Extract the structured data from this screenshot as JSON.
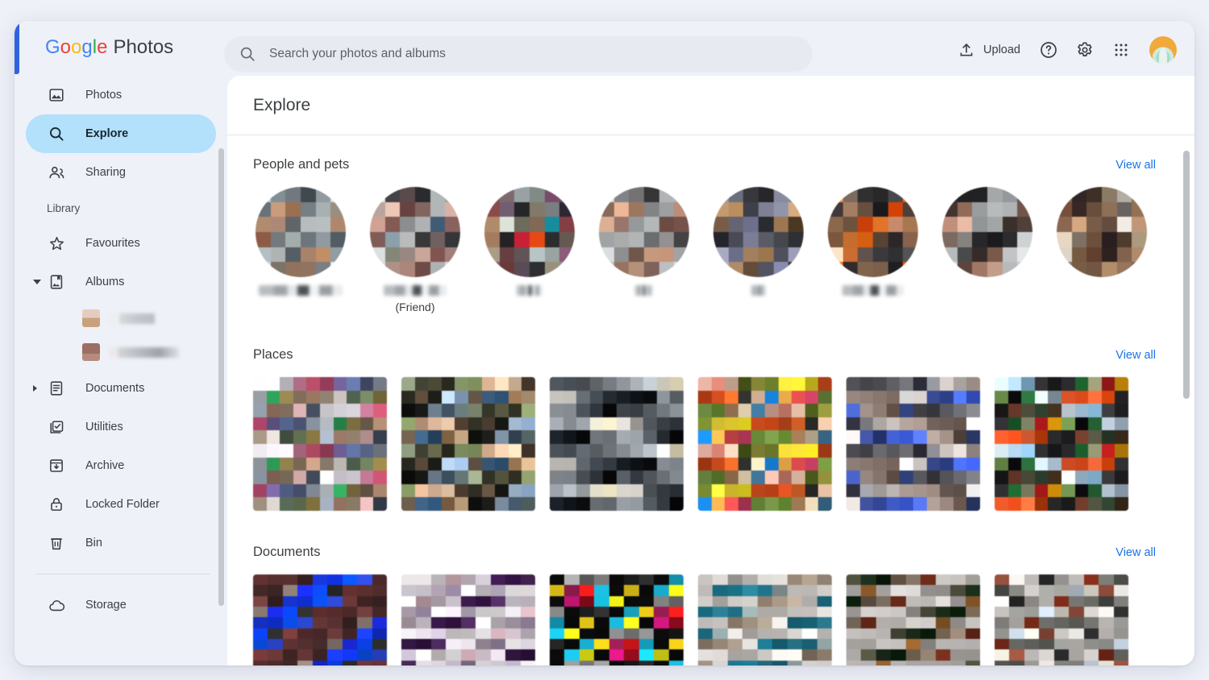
{
  "app": {
    "brand_google": [
      "G",
      "o",
      "o",
      "g",
      "l",
      "e"
    ],
    "brand_word": "Photos",
    "accent_blue": "#2f63e0"
  },
  "search": {
    "placeholder": "Search your photos and albums",
    "value": "",
    "icon": "search-icon"
  },
  "toolbar": {
    "upload_label": "Upload",
    "upload_icon": "upload-icon",
    "help_icon": "help-circle-icon",
    "settings_icon": "gear-icon",
    "apps_icon": "apps-grid-icon",
    "avatar_icon": "account-avatar"
  },
  "sidebar": {
    "items": [
      {
        "label": "Photos",
        "icon": "photo-icon",
        "active": false
      },
      {
        "label": "Explore",
        "icon": "search-icon",
        "active": true
      },
      {
        "label": "Sharing",
        "icon": "people-share-icon",
        "active": false
      }
    ],
    "library_label": "Library",
    "library_items": [
      {
        "label": "Favourites",
        "icon": "star-icon",
        "active": false,
        "caret": null
      },
      {
        "label": "Albums",
        "icon": "album-icon",
        "active": false,
        "caret": "open"
      },
      {
        "label": "Documents",
        "icon": "document-icon",
        "active": false,
        "caret": "closed"
      },
      {
        "label": "Utilities",
        "icon": "utilities-icon",
        "active": false,
        "caret": null
      },
      {
        "label": "Archive",
        "icon": "archive-icon",
        "active": false,
        "caret": null
      },
      {
        "label": "Locked Folder",
        "icon": "lock-icon",
        "active": false,
        "caret": null
      },
      {
        "label": "Bin",
        "icon": "trash-icon",
        "active": false,
        "caret": null
      }
    ],
    "album_children": [
      {
        "label_redacted": true,
        "label_width": 56,
        "thumb_color": "#c9a27b"
      },
      {
        "label_redacted": true,
        "label_width": 86,
        "thumb_color": "#9b6f62"
      }
    ],
    "footer_items": [
      {
        "label": "Storage",
        "icon": "cloud-icon",
        "active": false
      }
    ],
    "highlight_color": "#b3e0fb"
  },
  "main": {
    "page_title": "Explore",
    "view_all_label": "View all",
    "link_color": "#1a73e8",
    "sections": [
      {
        "title": "People and pets",
        "type": "people",
        "people": [
          {
            "name_redacted": true,
            "name_width": 104,
            "caption": "",
            "palette": [
              "#b9c0c0",
              "#6f7b80",
              "#8b949a",
              "#49525a",
              "#97a0a4",
              "#cfd5d4",
              "#5c666e",
              "#a9836a",
              "#b6855f",
              "#7f8a90",
              "#a9b1b2",
              "#8f8578",
              "#9a7a62",
              "#8e7160",
              "#6e747a",
              "#c2c8c8",
              "#b5bcbd",
              "#a07c63",
              "#7a4f3c",
              "#8d949a"
            ]
          },
          {
            "name_redacted": true,
            "name_width": 78,
            "caption": "(Friend)",
            "palette": [
              "#cfd2d0",
              "#3a3a3c",
              "#6c5c5c",
              "#2f3034",
              "#b8bcbd",
              "#9aa08e",
              "#a6948e",
              "#c9a79a",
              "#7a4f4b",
              "#8c6f69",
              "#b3b7b8",
              "#caa79c",
              "#b78d82",
              "#6d4a46",
              "#9fa3a4",
              "#b9bcbd",
              "#3f5a72",
              "#7e5a55",
              "#6f4f4b",
              "#a9c3d1"
            ]
          },
          {
            "name_redacted": true,
            "name_width": 32,
            "caption": "",
            "palette": [
              "#7a4a4c",
              "#6a5a5e",
              "#b9c6c8",
              "#8f9a96",
              "#7b4f6b",
              "#6e4a5c",
              "#7c4242",
              "#5f4f5e",
              "#2d2d30",
              "#8d8572",
              "#7b7e83",
              "#2a2430",
              "#9a7a5c",
              "#b6bbb0",
              "#7e7b6a",
              "#8a6f5a",
              "#178a9a",
              "#7a3a3e",
              "#8e6a52",
              "#2b2b2e",
              "#e0243c",
              "#ef4b16",
              "#2a2a2c",
              "#5b504a",
              "#8e8470"
            ]
          },
          {
            "name_redacted": true,
            "name_width": 22,
            "caption": "",
            "palette": [
              "#c6cbcb",
              "#6f7174",
              "#8d8b8c",
              "#3c3c3e",
              "#b7babc",
              "#a8aaa9",
              "#7a5f52",
              "#c79a80",
              "#ba8c72",
              "#8e8f91",
              "#9ea1a2",
              "#b08470",
              "#c09a82",
              "#7d6158",
              "#adb0b1",
              "#bfc2c3",
              "#6a4a42",
              "#6b4b44",
              "#8a8c8d",
              "#cfd2d2"
            ]
          },
          {
            "name_redacted": true,
            "name_width": 18,
            "caption": "",
            "palette": [
              "#8a8ca8",
              "#5c5f6a",
              "#43434a",
              "#2a2a30",
              "#8f8fa4",
              "#7f82a0",
              "#b08a66",
              "#9d7750",
              "#4a4a58",
              "#8a8ba2",
              "#9196ab",
              "#c9a07a",
              "#6a513f",
              "#52525f",
              "#7d80a0",
              "#2c2c34",
              "#9a7550",
              "#46331f",
              "#1f1f26",
              "#5a5a6a"
            ]
          },
          {
            "name_redacted": true,
            "name_width": 76,
            "caption": "",
            "palette": [
              "#f2803a",
              "#6a5a52",
              "#3a3a3c",
              "#2d2d2f",
              "#4a4a4c",
              "#e85c12",
              "#3a3234",
              "#8a6a52",
              "#7a5d4a",
              "#1c1c1e",
              "#d84206",
              "#4a3a32",
              "#7a5a42",
              "#5a4432",
              "#e8480a",
              "#ef7a2a",
              "#c4886a",
              "#9a6c4a",
              "#6a4a34",
              "#f0853a",
              "#ef6a14",
              "#5a4436",
              "#2a2426",
              "#7a5844",
              "#f0c0a8"
            ]
          },
          {
            "name_redacted": true,
            "name_width": 0,
            "caption": "",
            "palette": [
              "#2c2c2e",
              "#1c1c1e",
              "#2a2a2c",
              "#b9bcbd",
              "#9a9d9f",
              "#555759",
              "#3a2f2c",
              "#7a5a4a",
              "#b6b9ba",
              "#c8cbcc",
              "#b1b4b5",
              "#6c4f45",
              "#a97e6c",
              "#c19a88",
              "#a8abac",
              "#adb0b1",
              "#3a2e2b",
              "#4a3a34",
              "#6a5a52",
              "#a29f9c"
            ]
          },
          {
            "name_redacted": true,
            "name_width": 0,
            "caption": "",
            "palette": [
              "#7a5a42",
              "#2a2020",
              "#4a3a2c",
              "#9a8a72",
              "#b9b3a8",
              "#8a6a4a",
              "#6a4634",
              "#2e2220",
              "#7a5c48",
              "#9a7a5e",
              "#6a6460",
              "#8a6a50",
              "#7a5a48",
              "#b08a6a",
              "#8a6a52",
              "#6a5244",
              "#efe8e0",
              "#b08a6e",
              "#c8b8a8",
              "#9a8a7a"
            ]
          }
        ]
      },
      {
        "title": "Places",
        "type": "tiles",
        "tiles": [
          {
            "palette": [
              "#ece8ee",
              "#e6e2ea",
              "#dcd6de",
              "#c57a95",
              "#c2526e",
              "#8e3a56",
              "#6a5a8e",
              "#5a6a96",
              "#4a5270",
              "#7e8692",
              "#9aa0a6",
              "#2e9a56",
              "#8a7a4a",
              "#6a5a4a",
              "#b08a72",
              "#9a8a7a",
              "#c8c2bc",
              "#4a5a4a",
              "#6a7a5a",
              "#8a7a42",
              "#a8b4c4",
              "#8a6a5a",
              "#7a6a5a",
              "#caa2a2",
              "#3a4250"
            ]
          },
          {
            "palette": [
              "#8e9a7e",
              "#3a3a2e",
              "#5a5a42",
              "#2e2e22",
              "#8a9a6a",
              "#7a8a5a",
              "#c8a284",
              "#ecc2a4",
              "#e8c8a8",
              "#4a3a2e",
              "#2a2a20",
              "#5a4a3a",
              "#1a1a16",
              "#a8c0d8",
              "#8ea8c8",
              "#6a5a4a",
              "#3a5a7a",
              "#2a4a6a",
              "#8a6a4a",
              "#c8a884",
              "#0e0e0c",
              "#1a1a18",
              "#6a7a8a",
              "#3a4a5a",
              "#5a6a6a"
            ]
          },
          {
            "palette": [
              "#4a5056",
              "#3e444a",
              "#565c62",
              "#6a7076",
              "#7a8086",
              "#8a9096",
              "#9aa0a6",
              "#aab0b6",
              "#f0ecd8",
              "#e8e0c0",
              "#c8c4be",
              "#b8b4ae",
              "#5a6066",
              "#3a4046",
              "#2a3036",
              "#1a2026",
              "#0e1216",
              "#080a0c",
              "#7a8086",
              "#6a7076",
              "#9aa0a6",
              "#8a9096",
              "#4a5056",
              "#2a3036",
              "#060608"
            ]
          },
          {
            "palette": [
              "#d8a89a",
              "#c87a6a",
              "#e8c0a8",
              "#4a5a1a",
              "#8a8a3a",
              "#6a7a2a",
              "#f0d83a",
              "#e8d030",
              "#d8c820",
              "#b8441a",
              "#a83a14",
              "#c84a1e",
              "#e86a2a",
              "#2a2a28",
              "#f0c8a8",
              "#1a8ae8",
              "#e8a84a",
              "#d84a4a",
              "#b83a5a",
              "#6a8a3a",
              "#7a9a4a",
              "#5a7a2a",
              "#8a6a4a",
              "#c8b89a",
              "#3a6a8a"
            ]
          },
          {
            "palette": [
              "#4a4a50",
              "#3a3a40",
              "#5a5a60",
              "#6a6a70",
              "#7a7a80",
              "#2a2a36",
              "#8a8a90",
              "#b8b0ac",
              "#c8c0bc",
              "#a89890",
              "#988880",
              "#887870",
              "#786860",
              "#685850",
              "#f8f8f8",
              "#e8e0dc",
              "#3a4a8e",
              "#2a3a7e",
              "#4a6ae8",
              "#3a5ad8",
              "#5a7af8",
              "#a89890",
              "#887870",
              "#584840",
              "#2a3a6a"
            ]
          },
          {
            "palette": [
              "#d8e8f0",
              "#a8c8e0",
              "#88b8d8",
              "#3a3a3c",
              "#1a1a1c",
              "#2a2a2e",
              "#1a5a2a",
              "#8a8a6a",
              "#a81a1a",
              "#c88a0a",
              "#6a8a4a",
              "#0a0a0c",
              "#2a6a3a",
              "#c8d8e8",
              "#8a9aa8",
              "#e8582a",
              "#d8481a",
              "#f0683a",
              "#b83a0a",
              "#2a2a2c",
              "#1a1a1a",
              "#6a3a2a",
              "#4a4a3a",
              "#2a3a2a",
              "#3a2a1a"
            ]
          }
        ]
      },
      {
        "title": "Documents",
        "type": "doc-tiles",
        "tiles": [
          {
            "palette": [
              "#5a2e2e",
              "#4a2828",
              "#6a3a3a",
              "#3a2222",
              "#1a3ae8",
              "#1030d8",
              "#0a50f0",
              "#2a44c8",
              "#5a3030",
              "#4a2a2a",
              "#3a2424",
              "#8a7a72",
              "#1a2ae0",
              "#0a40e8",
              "#2a2a2a",
              "#6a3434"
            ]
          },
          {
            "palette": [
              "#d8d4d6",
              "#cac6c8",
              "#e0dce0",
              "#c8a8b0",
              "#b8aab4",
              "#d0c8d2",
              "#3a1a4a",
              "#2a1038",
              "#4a2a5a",
              "#dcd6de",
              "#c8c0c8",
              "#a89aa8",
              "#8a7a92",
              "#e8e4e8",
              "#d0c8d2",
              "#b8aec0"
            ]
          },
          {
            "palette": [
              "#0a0a0a",
              "#9a9a9a",
              "#6a6a6a",
              "#8a8a8a",
              "#0a0a0a",
              "#1a1a1a",
              "#2a2a2a",
              "#0a0a0a",
              "#18a8c8",
              "#e8c818",
              "#8a1a4a",
              "#e81a1a",
              "#18a8c8",
              "#0a0a0a",
              "#e8c818",
              "#0a0a0a",
              "#18a8c8",
              "#e8e818",
              "#0a0a0a",
              "#e81a8a",
              "#8a0a1a",
              "#18c8e8",
              "#e8e818",
              "#0a0a0a"
            ]
          },
          {
            "palette": [
              "#b8b4b0",
              "#c0bcb8",
              "#b4b0ac",
              "#c8c4c0",
              "#e8e4e0",
              "#dcd8d4",
              "#8a7a6a",
              "#9a8a7a",
              "#a89a8a",
              "#d0ccc8",
              "#1a6a80",
              "#186a7e",
              "#2a7a90",
              "#1a6074",
              "#8a9a9a",
              "#c8c4c0"
            ]
          },
          {
            "palette": [
              "#4a4a3a",
              "#1a2a1a",
              "#0a1a0a",
              "#6a5a4a",
              "#8a7a6a",
              "#6a2a1a",
              "#b8b4b0",
              "#a8a4a0",
              "#c0bcb8",
              "#b0acab",
              "#8a5a2a",
              "#9a9694",
              "#c8c4c2",
              "#b8b4b2",
              "#a8a4a2",
              "#989492"
            ]
          },
          {
            "palette": [
              "#8a4a3a",
              "#d8d4d0",
              "#e8e4e0",
              "#2a2a2a",
              "#9a9694",
              "#b8b4b0",
              "#7a2a1a",
              "#6a6a66",
              "#5a5a56",
              "#4a4a46",
              "#8a8a86",
              "#c8c4c0",
              "#9a9a96",
              "#8a8a86",
              "#b8c4d0",
              "#d8d4c8"
            ]
          }
        ]
      }
    ]
  }
}
